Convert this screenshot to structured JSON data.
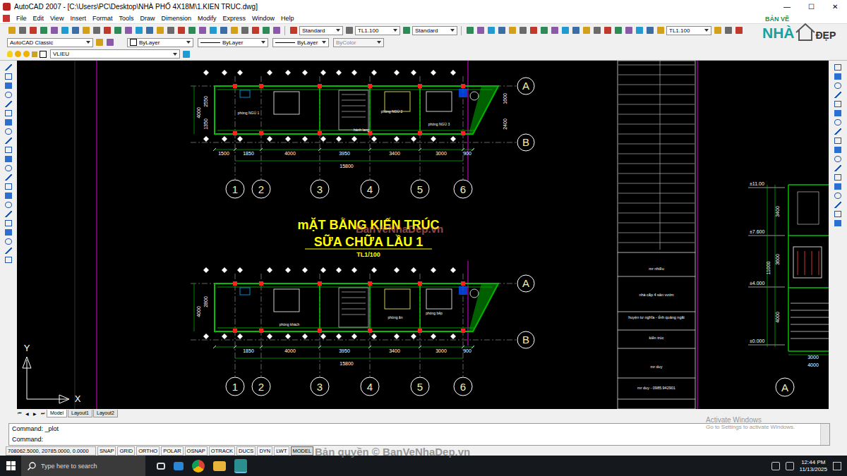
{
  "window": {
    "title": "AutoCAD 2007 - [C:\\Users\\PC\\Desktop\\NHÀ PHỐ 4X18M\\1.KIEN TRUC.dwg]",
    "controls": [
      "—",
      "☐",
      "✕"
    ]
  },
  "menu": [
    "File",
    "Edit",
    "View",
    "Insert",
    "Format",
    "Tools",
    "Draw",
    "Dimension",
    "Modify",
    "Express",
    "Window",
    "Help"
  ],
  "styles": {
    "text_style": "Standard",
    "dim_style": "TL1.100",
    "table_style": "Standard",
    "multileader_style": "TL1.100"
  },
  "workspace": "AutoCAD Classic",
  "layer": "VLIEU",
  "properties": {
    "color": "ByLayer",
    "linetype": "ByLayer",
    "lineweight": "ByLayer",
    "plot_style": {
      "value": "ByColor",
      "disabled": true
    }
  },
  "drawing": {
    "sheet_title": {
      "lines": [
        "mẶT BẰNG KIẾN TRÚC",
        "SỮA CHỮA LẦU 1"
      ],
      "scale": "TL1/100"
    },
    "plans": [
      {
        "dims": [
          "1500",
          "1850",
          "4000",
          "3950",
          "3400",
          "3000",
          "900"
        ],
        "total": "15800",
        "axes": [
          "1",
          "2",
          "3",
          "4",
          "5",
          "6"
        ],
        "rows": [
          "A",
          "B"
        ],
        "left_dims": [
          "4000",
          "2550",
          "1350"
        ],
        "right_dims": [
          "1600",
          "2400"
        ],
        "rooms": [
          "phòng NGỦ 1",
          "phòng NGỦ 2",
          "phòng NGỦ 3",
          "hành lang"
        ]
      },
      {
        "dims": [
          "1850",
          "4000",
          "3950",
          "3400",
          "3000",
          "900"
        ],
        "total": "15800",
        "axes": [
          "1",
          "2",
          "3",
          "4",
          "5",
          "6"
        ],
        "rows": [
          "A",
          "B"
        ],
        "left_dims": [
          "4000",
          "2800"
        ],
        "right_dims": [],
        "rooms": [
          "phòng khách",
          "phòng ăn",
          "phòng bếp"
        ]
      }
    ],
    "title_block": [
      "mr nhiều",
      "nhà cấp 4 sân vườn",
      "huyện tư nghĩa - tỉnh quảng ngãi",
      "kiến trúc",
      "mr duy",
      "mr duy - 0985.942901"
    ],
    "elevation": {
      "levels": [
        "±11.00",
        "±7.600",
        "±4.000",
        "±0.000"
      ],
      "dims": [
        "3400",
        "11000",
        "3600",
        "4000"
      ],
      "bottom_dims": [
        "3000",
        "4000"
      ],
      "axis": "A"
    },
    "ucs": [
      "Y",
      "X"
    ],
    "watermark": "BanVeNhaDep.vn"
  },
  "tab_nav": [
    "⏮",
    "◀",
    "▶",
    "⏭"
  ],
  "layout_tabs": [
    {
      "label": "Model",
      "selected": true
    },
    {
      "label": "Layout1",
      "selected": false
    },
    {
      "label": "Layout2",
      "selected": false
    }
  ],
  "command_lines": [
    "Command: _plot",
    "Command:"
  ],
  "status_bar": {
    "coordinates": "708062.5000, 20785.0000, 0.0000",
    "toggles": [
      {
        "label": "SNAP",
        "on": false
      },
      {
        "label": "GRID",
        "on": false
      },
      {
        "label": "ORTHO",
        "on": false
      },
      {
        "label": "POLAR",
        "on": false
      },
      {
        "label": "OSNAP",
        "on": false
      },
      {
        "label": "OTRACK",
        "on": false
      },
      {
        "label": "DUCS",
        "on": false
      },
      {
        "label": "DYN",
        "on": false
      },
      {
        "label": "LWT",
        "on": false
      },
      {
        "label": "MODEL",
        "on": true
      }
    ]
  },
  "taskbar": {
    "search_placeholder": "Type here to search",
    "time": "12:44 PM",
    "date": "11/13/2025"
  },
  "logo": [
    "BẢN VẼ",
    "NHÀ",
    "ĐẸP"
  ],
  "copyright": "Bản quyền © BanVeNhaDep.vn",
  "activation": [
    "Activate Windows",
    "Go to Settings to activate Windows."
  ]
}
